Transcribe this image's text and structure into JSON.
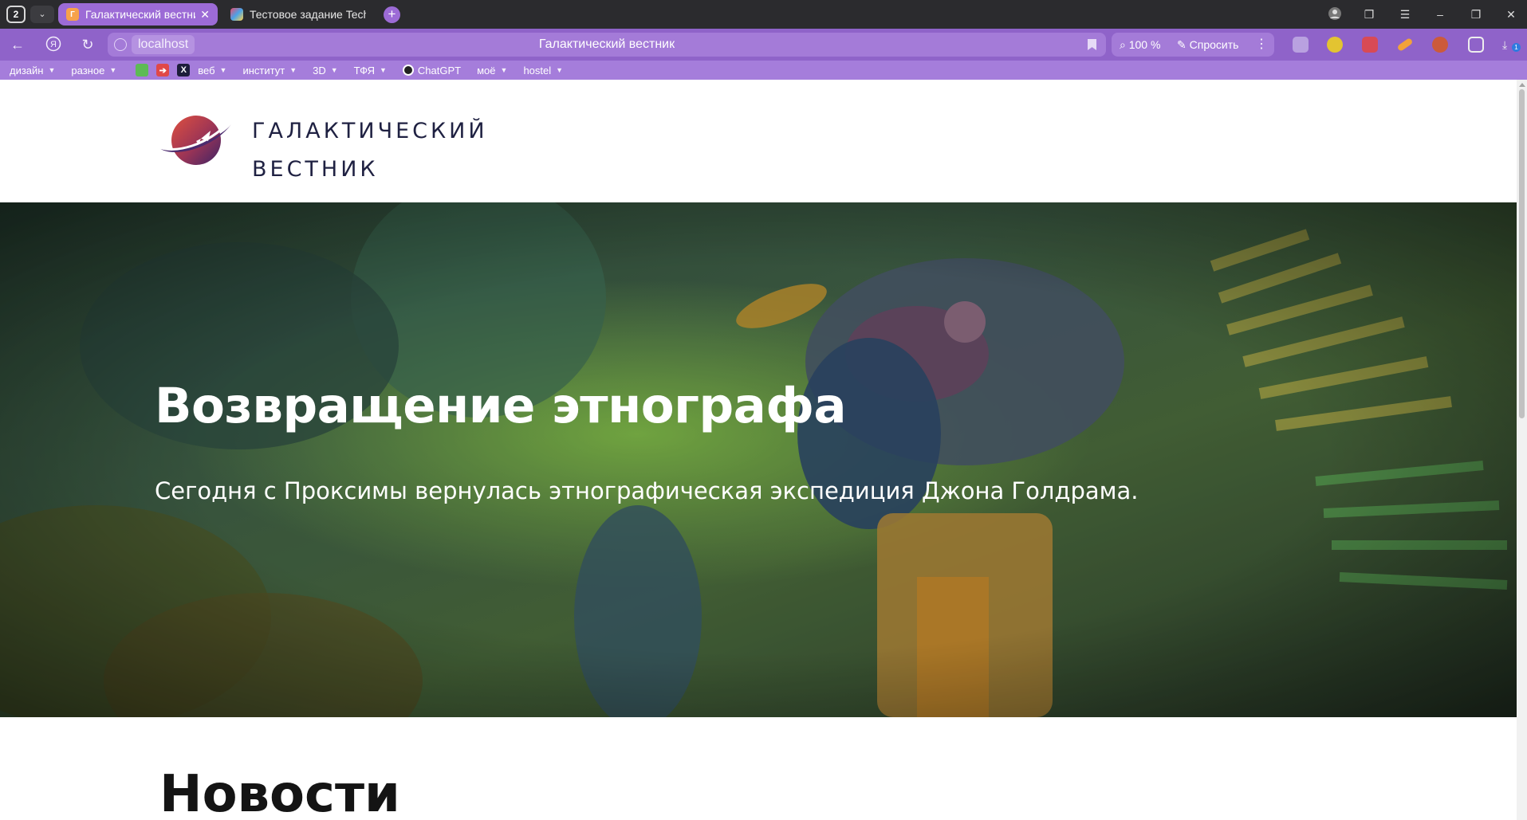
{
  "browser": {
    "tab_count": "2",
    "tabs": [
      {
        "title": "Галактический вестник",
        "favicon": "galaxy-favicon",
        "active": true
      },
      {
        "title": "Тестовое задание Techart",
        "favicon": "techart-favicon",
        "active": false
      }
    ],
    "url_host": "localhost",
    "page_title": "Галактический вестник",
    "zoom": "100 %",
    "ask_label": "Спросить",
    "download_badge": "1",
    "colors": {
      "accent": "#9c6bd6",
      "toolbar": "#8f63c9",
      "bookmarks": "#a57ddb"
    }
  },
  "bookmarks": [
    {
      "label": "дизайн",
      "folder": true
    },
    {
      "label": "разное",
      "folder": true
    },
    {
      "icon": "green-bookmark-icon"
    },
    {
      "icon": "red-arrow-bookmark-icon"
    },
    {
      "icon": "x-bookmark-icon"
    },
    {
      "label": "веб",
      "folder": true
    },
    {
      "label": "институт",
      "folder": true
    },
    {
      "label": "3D",
      "folder": true
    },
    {
      "label": "ТФЯ",
      "folder": true
    },
    {
      "label": "ChatGPT",
      "folder": false
    },
    {
      "label": "моё",
      "folder": true
    },
    {
      "label": "hostel",
      "folder": true
    }
  ],
  "site": {
    "logo_line1": "ГАЛАКТИЧЕСКИЙ",
    "logo_line2": "ВЕСТНИК",
    "hero": {
      "title": "Возвращение этнографа",
      "lead": "Сегодня с Проксимы вернулась этнографическая экспедиция Джона Голдрама."
    },
    "news_heading": "Новости",
    "colors": {
      "logo_text": "#1f2142",
      "logo_red": "#c94040",
      "logo_purple": "#4b2a6e"
    }
  }
}
